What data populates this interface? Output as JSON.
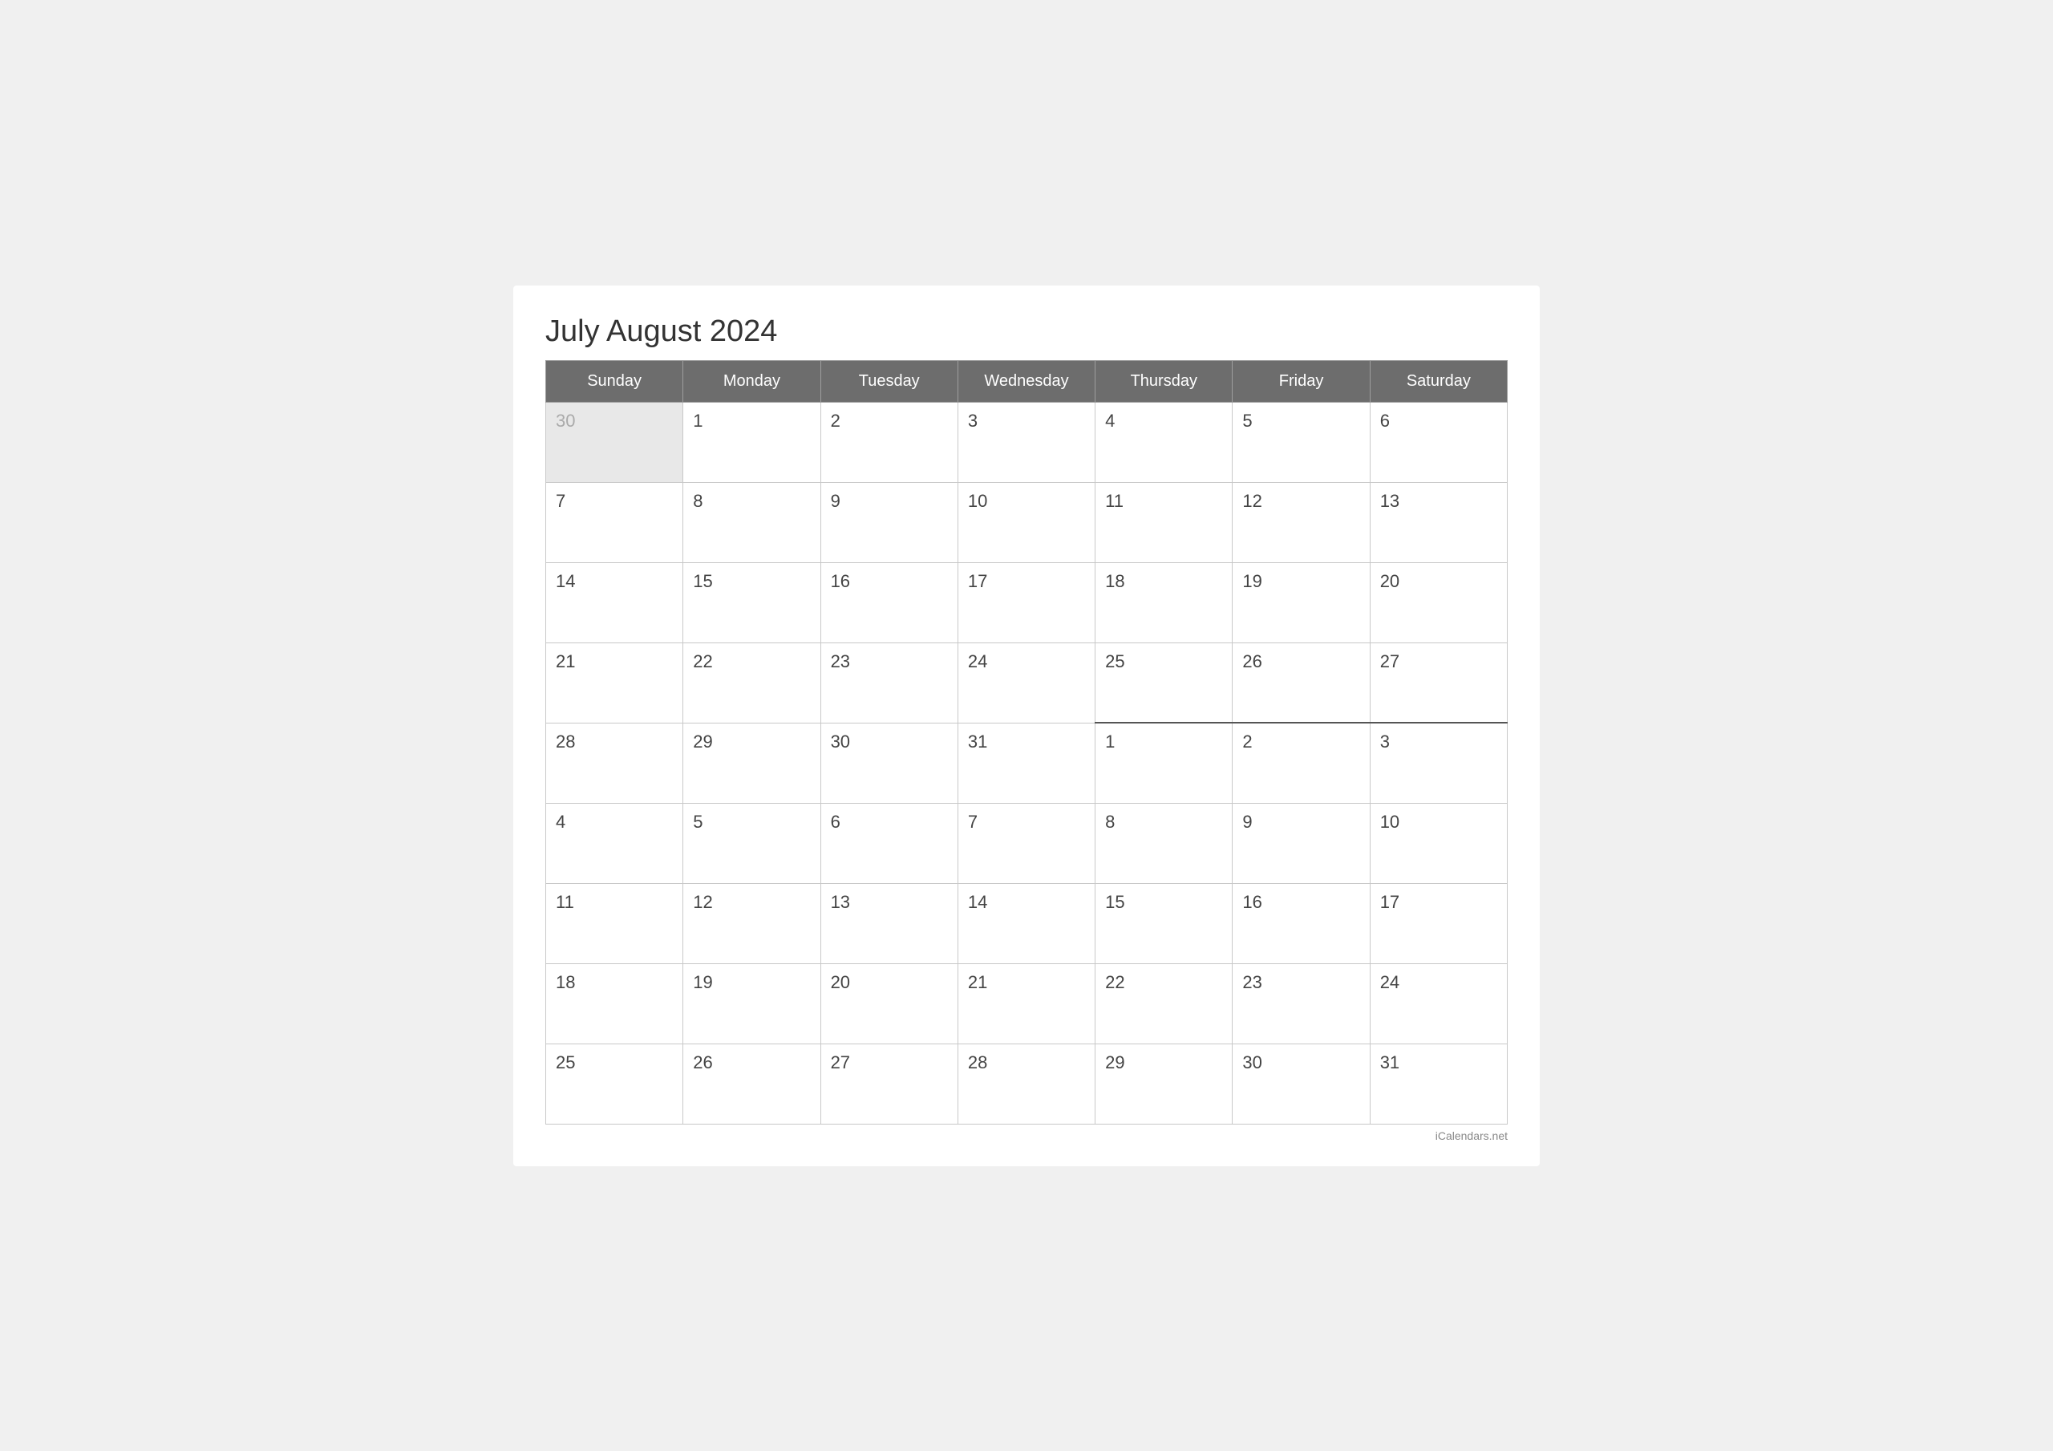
{
  "calendar": {
    "title": "July August 2024",
    "watermark": "iCalendars.net",
    "headers": [
      "Sunday",
      "Monday",
      "Tuesday",
      "Wednesday",
      "Thursday",
      "Friday",
      "Saturday"
    ],
    "weeks": [
      {
        "divider": false,
        "days": [
          {
            "date": "30",
            "type": "prev-month"
          },
          {
            "date": "1",
            "type": "current"
          },
          {
            "date": "2",
            "type": "current"
          },
          {
            "date": "3",
            "type": "current"
          },
          {
            "date": "4",
            "type": "current"
          },
          {
            "date": "5",
            "type": "current"
          },
          {
            "date": "6",
            "type": "current"
          }
        ]
      },
      {
        "divider": false,
        "days": [
          {
            "date": "7",
            "type": "current"
          },
          {
            "date": "8",
            "type": "current"
          },
          {
            "date": "9",
            "type": "current"
          },
          {
            "date": "10",
            "type": "current"
          },
          {
            "date": "11",
            "type": "current"
          },
          {
            "date": "12",
            "type": "current"
          },
          {
            "date": "13",
            "type": "current"
          }
        ]
      },
      {
        "divider": false,
        "days": [
          {
            "date": "14",
            "type": "current"
          },
          {
            "date": "15",
            "type": "current"
          },
          {
            "date": "16",
            "type": "current"
          },
          {
            "date": "17",
            "type": "current"
          },
          {
            "date": "18",
            "type": "current"
          },
          {
            "date": "19",
            "type": "current"
          },
          {
            "date": "20",
            "type": "current"
          }
        ]
      },
      {
        "divider": false,
        "days": [
          {
            "date": "21",
            "type": "current"
          },
          {
            "date": "22",
            "type": "current"
          },
          {
            "date": "23",
            "type": "current"
          },
          {
            "date": "24",
            "type": "current"
          },
          {
            "date": "25",
            "type": "current"
          },
          {
            "date": "26",
            "type": "current"
          },
          {
            "date": "27",
            "type": "current"
          }
        ]
      },
      {
        "divider": false,
        "days": [
          {
            "date": "28",
            "type": "current"
          },
          {
            "date": "29",
            "type": "current"
          },
          {
            "date": "30",
            "type": "current"
          },
          {
            "date": "31",
            "type": "current"
          },
          {
            "date": "1",
            "type": "next-divider"
          },
          {
            "date": "2",
            "type": "next-month"
          },
          {
            "date": "3",
            "type": "next-month"
          }
        ]
      },
      {
        "divider": false,
        "days": [
          {
            "date": "4",
            "type": "next-month"
          },
          {
            "date": "5",
            "type": "next-month"
          },
          {
            "date": "6",
            "type": "next-month"
          },
          {
            "date": "7",
            "type": "next-month"
          },
          {
            "date": "8",
            "type": "next-month"
          },
          {
            "date": "9",
            "type": "next-month"
          },
          {
            "date": "10",
            "type": "next-month"
          }
        ]
      },
      {
        "divider": false,
        "days": [
          {
            "date": "11",
            "type": "next-month"
          },
          {
            "date": "12",
            "type": "next-month"
          },
          {
            "date": "13",
            "type": "next-month"
          },
          {
            "date": "14",
            "type": "next-month"
          },
          {
            "date": "15",
            "type": "next-month"
          },
          {
            "date": "16",
            "type": "next-month"
          },
          {
            "date": "17",
            "type": "next-month"
          }
        ]
      },
      {
        "divider": false,
        "days": [
          {
            "date": "18",
            "type": "next-month"
          },
          {
            "date": "19",
            "type": "next-month"
          },
          {
            "date": "20",
            "type": "next-month"
          },
          {
            "date": "21",
            "type": "next-month"
          },
          {
            "date": "22",
            "type": "next-month"
          },
          {
            "date": "23",
            "type": "next-month"
          },
          {
            "date": "24",
            "type": "next-month"
          }
        ]
      },
      {
        "divider": false,
        "days": [
          {
            "date": "25",
            "type": "next-month"
          },
          {
            "date": "26",
            "type": "next-month"
          },
          {
            "date": "27",
            "type": "next-month"
          },
          {
            "date": "28",
            "type": "next-month"
          },
          {
            "date": "29",
            "type": "next-month"
          },
          {
            "date": "30",
            "type": "next-month"
          },
          {
            "date": "31",
            "type": "next-month"
          }
        ]
      }
    ]
  }
}
